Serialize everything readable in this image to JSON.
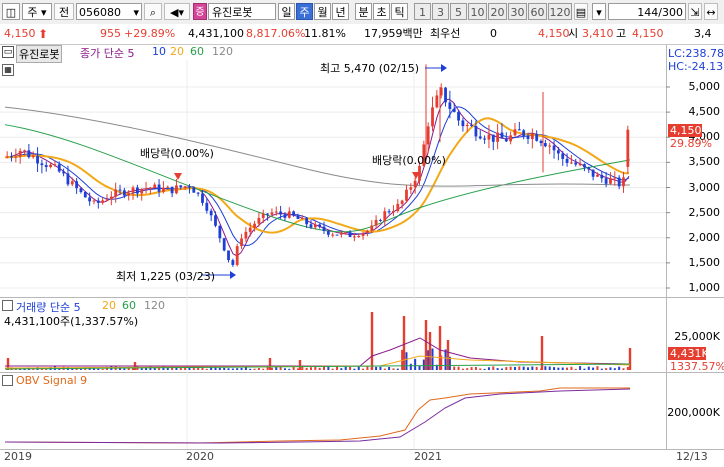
{
  "toolbar": {
    "market": "주",
    "prefix": "전",
    "code": "056080",
    "name": "유진로봇",
    "periods": [
      "일",
      "주",
      "월",
      "년",
      "분",
      "초",
      "틱"
    ],
    "selected_period": "주",
    "intervals": [
      "1",
      "3",
      "5",
      "10",
      "20",
      "30",
      "60",
      "120"
    ],
    "count": "144",
    "count_total": "/300"
  },
  "quote": {
    "price": "4,150",
    "change": "955",
    "change_pct": "+29.89%",
    "volume": "4,431,100",
    "volume_pct": "8,817.06%",
    "turnover_pct": "11.81%",
    "amount": "17,959백만",
    "tag": "최우선",
    "bid_qty": "0",
    "ask": "4,150",
    "open_label": "시",
    "open": "3,410",
    "high_label": "고",
    "high": "4,150",
    "extra": "3,4"
  },
  "price_pane": {
    "legend": {
      "name": "유진로봇",
      "ma_label": "종가 단순 5",
      "ma": [
        "10",
        "20",
        "60",
        "120"
      ]
    },
    "lc": "LC:238.78",
    "hc": "HC:-24.13",
    "max_label": "최고 5,470 (02/15)",
    "min_label": "최저 1,225 (03/23)",
    "dividend_1": "배당락(0.00%)",
    "dividend_2": "배당락(0.00%)",
    "last_price": "4,150",
    "last_pct": "29.89%",
    "yticks": [
      "5,000",
      "4,500",
      "4,000",
      "3,500",
      "3,000",
      "2,500",
      "2,000",
      "1,500",
      "1,000"
    ]
  },
  "volume_pane": {
    "legend": "거래량 단순 5",
    "ma": [
      "20",
      "60",
      "120"
    ],
    "value_line": "4,431,100주(1,337.57%)",
    "ytick": "25,000K",
    "last_value": "4,431K",
    "last_pct": "1337.57%"
  },
  "obv_pane": {
    "legend": "OBV  Signal 9",
    "ytick": "200,000K"
  },
  "xaxis": [
    "2019",
    "2020",
    "2021",
    "12/13"
  ],
  "colors": {
    "up": "#e53e30",
    "down": "#1c3fd6",
    "ma5": "#8b1a8b",
    "ma10": "#1c3fd6",
    "ma20": "#f2a818",
    "ma60": "#27a04a",
    "ma120": "#8a8a8a",
    "obv": "#e06a1b",
    "signal": "#7a2ca0"
  }
}
